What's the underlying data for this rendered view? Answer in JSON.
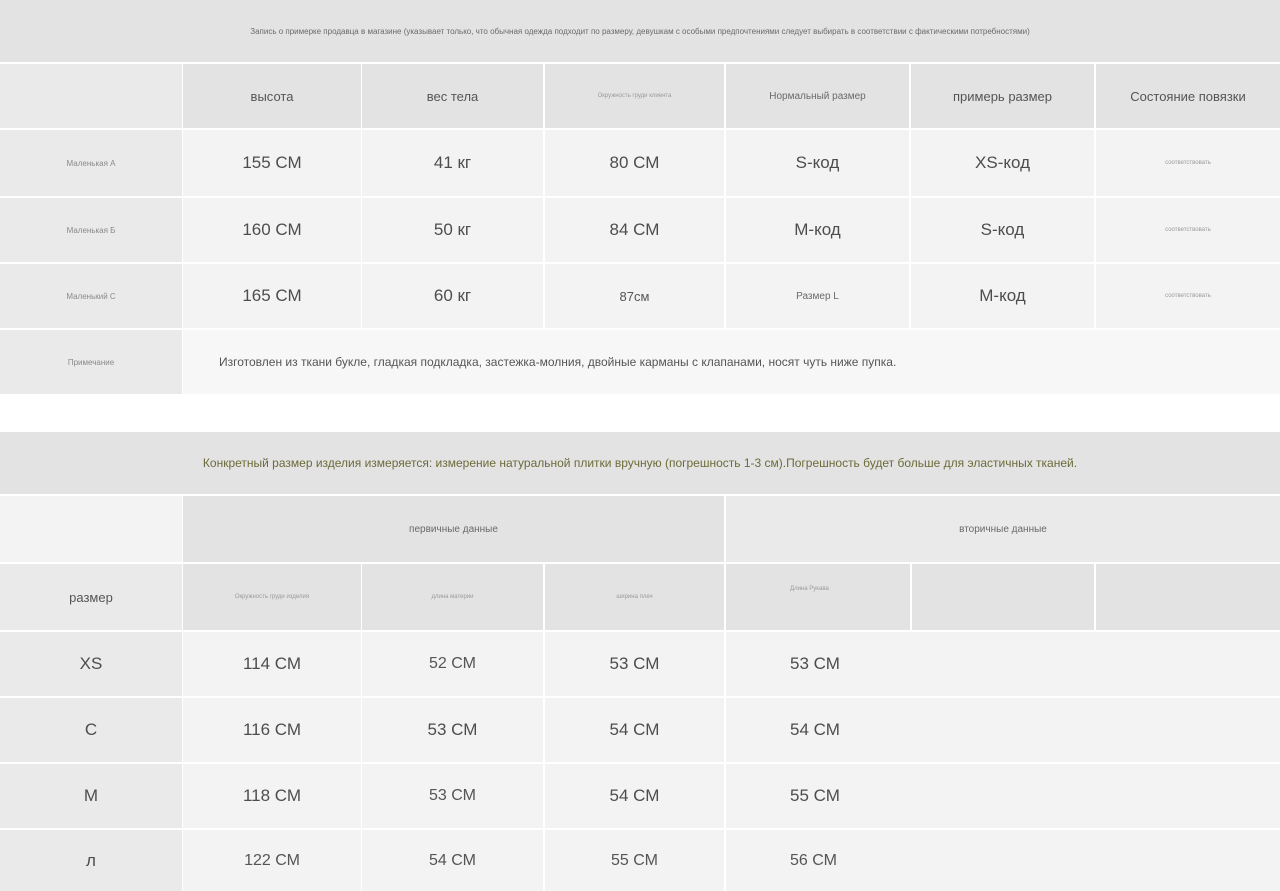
{
  "top_section": {
    "banner": "Запись о примерке продавца в магазине (указывает только, что обычная одежда подходит по размеру, девушкам с особыми предпочтениями следует выбирать в соответствии с фактическими потребностями)",
    "headers": [
      "высота",
      "вес тела",
      "Окружность груди клиента",
      "Нормальный размер",
      "примерь размер",
      "Состояние повязки"
    ],
    "rows": [
      {
        "label": "Маленькая А",
        "values": [
          "155 СМ",
          "41 кг",
          "80 СМ",
          "S-код",
          "XS-код",
          "соответствовать"
        ]
      },
      {
        "label": "Маленькая Б",
        "values": [
          "160 СМ",
          "50 кг",
          "84 СМ",
          "М-код",
          "S-код",
          "соответствовать"
        ]
      },
      {
        "label": "Маленький С",
        "values": [
          "165 СМ",
          "60 кг",
          "87см",
          "Размер L",
          "М-код",
          "соответствовать"
        ]
      }
    ],
    "note_label": "Примечание",
    "note_text": "Изготовлен из ткани букле, гладкая подкладка, застежка-молния, двойные карманы с клапанами, носят чуть ниже пупка."
  },
  "bottom_section": {
    "banner": "Конкретный размер изделия измеряется: измерение натуральной плитки вручную (погрешность 1-3 см).Погрешность будет больше для эластичных тканей.",
    "group_primary": "первичные данные",
    "group_secondary": "вторичные данные",
    "size_label": "размер",
    "headers": [
      "Окружность груди изделия",
      "длина материи",
      "ширина плеч",
      "Длина Рукава"
    ],
    "rows": [
      {
        "size": "XS",
        "values": [
          "114 СМ",
          "52 СМ",
          "53 СМ",
          "53 СМ"
        ]
      },
      {
        "size": "С",
        "values": [
          "116 СМ",
          "53 СМ",
          "54 СМ",
          "54 СМ"
        ]
      },
      {
        "size": "М",
        "values": [
          "118 СМ",
          "53 СМ",
          "54 СМ",
          "55 СМ"
        ]
      },
      {
        "size": "л",
        "values": [
          "122 СМ",
          "54 СМ",
          "55 СМ",
          "56 СМ"
        ]
      }
    ]
  }
}
